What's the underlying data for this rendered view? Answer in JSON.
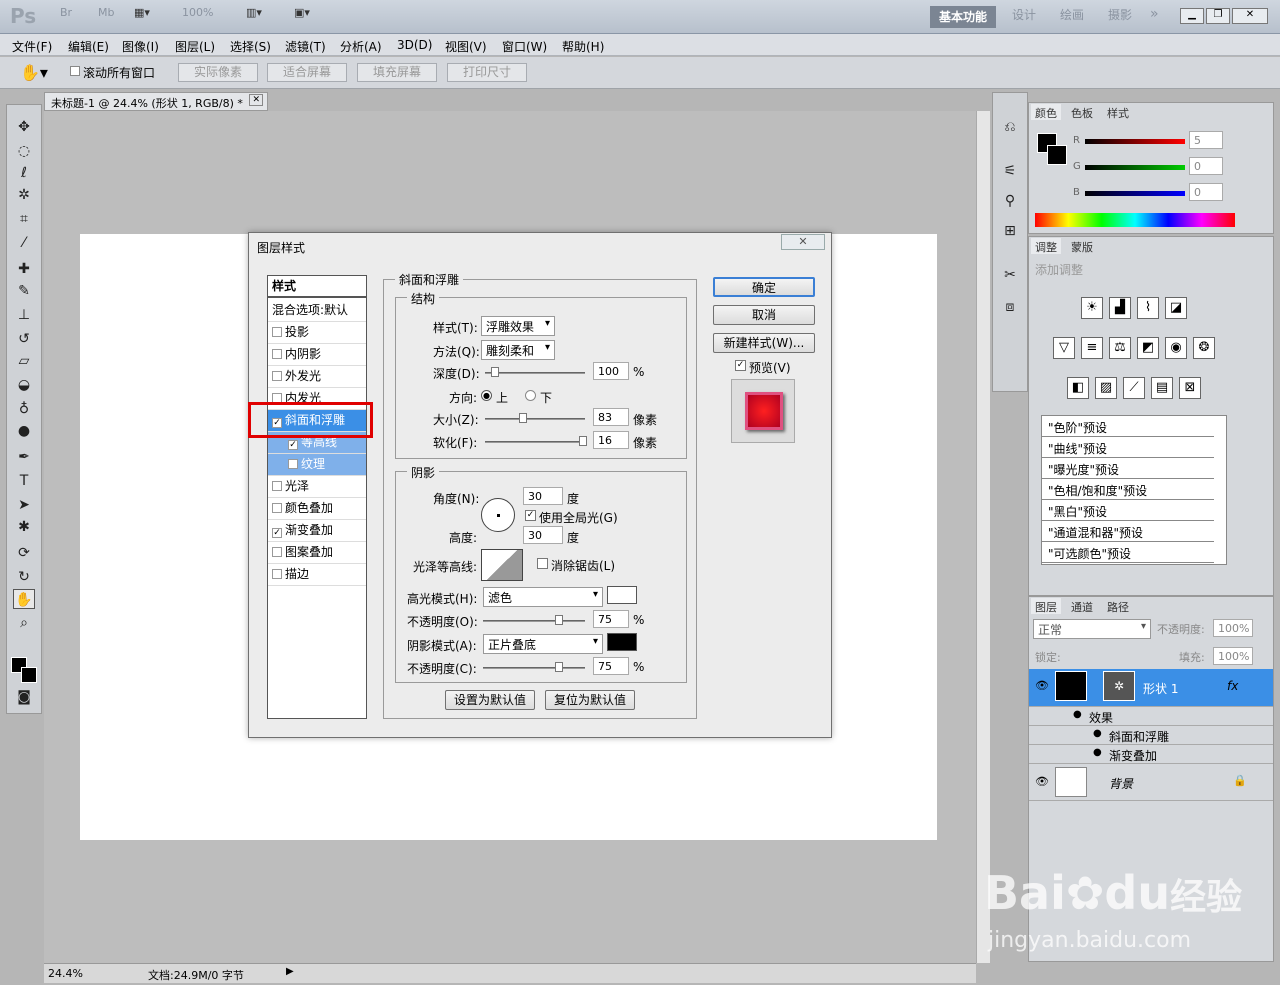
{
  "app": {
    "logo": "Ps",
    "top_items": [
      "Br",
      "Mb",
      "100%"
    ],
    "workspace": "基本功能",
    "workspaces": [
      "设计",
      "绘画",
      "摄影"
    ]
  },
  "menu": [
    "文件(F)",
    "编辑(E)",
    "图像(I)",
    "图层(L)",
    "选择(S)",
    "滤镜(T)",
    "分析(A)",
    "3D(D)",
    "视图(V)",
    "窗口(W)",
    "帮助(H)"
  ],
  "options": {
    "scroll_all": "滚动所有窗口",
    "buttons": [
      "实际像素",
      "适合屏幕",
      "填充屏幕",
      "打印尺寸"
    ]
  },
  "doc": {
    "tab": "未标题-1 @ 24.4% (形状 1, RGB/8) *",
    "zoom": "24.4%",
    "status": "文档:24.9M/0 字节"
  },
  "dialog": {
    "title": "图层样式",
    "close": "✕",
    "styles_header": "样式",
    "blend": "混合选项:默认",
    "items": [
      {
        "label": "投影",
        "checked": ""
      },
      {
        "label": "内阴影",
        "checked": ""
      },
      {
        "label": "外发光",
        "checked": ""
      },
      {
        "label": "内发光",
        "checked": ""
      },
      {
        "label": "斜面和浮雕",
        "checked": "✓"
      },
      {
        "label": "等高线",
        "checked": "✓"
      },
      {
        "label": "纹理",
        "checked": ""
      },
      {
        "label": "光泽",
        "checked": ""
      },
      {
        "label": "颜色叠加",
        "checked": ""
      },
      {
        "label": "渐变叠加",
        "checked": "✓"
      },
      {
        "label": "图案叠加",
        "checked": ""
      },
      {
        "label": "描边",
        "checked": ""
      }
    ],
    "bevel_title": "斜面和浮雕",
    "structure": "结构",
    "style_label": "样式(T):",
    "style_value": "浮雕效果",
    "method_label": "方法(Q):",
    "method_value": "雕刻柔和",
    "depth_label": "深度(D):",
    "depth_value": "100",
    "pct": "%",
    "direction_label": "方向:",
    "dir_up": "上",
    "dir_down": "下",
    "size_label": "大小(Z):",
    "size_value": "83",
    "px": "像素",
    "soften_label": "软化(F):",
    "soften_value": "16",
    "shading": "阴影",
    "angle_label": "角度(N):",
    "angle_value": "30",
    "deg": "度",
    "global_light": "使用全局光(G)",
    "altitude_label": "高度:",
    "altitude_value": "30",
    "gloss_label": "光泽等高线:",
    "antialias": "消除锯齿(L)",
    "hl_mode_label": "高光模式(H):",
    "hl_mode": "滤色",
    "opacity_label": "不透明度(O):",
    "hl_opacity": "75",
    "sh_mode_label": "阴影模式(A):",
    "sh_mode": "正片叠底",
    "opacity2_label": "不透明度(C):",
    "sh_opacity": "75",
    "set_default": "设置为默认值",
    "reset_default": "复位为默认值",
    "ok": "确定",
    "cancel": "取消",
    "new_style": "新建样式(W)...",
    "preview": "预览(V)"
  },
  "color_panel": {
    "tabs": [
      "颜色",
      "色板",
      "样式"
    ],
    "r": "5",
    "g": "0",
    "b": "0",
    "r_l": "R",
    "g_l": "G",
    "b_l": "B"
  },
  "adjust_panel": {
    "tabs": [
      "调整",
      "蒙版"
    ],
    "hint": "添加调整",
    "presets": [
      "\"色阶\"预设",
      "\"曲线\"预设",
      "\"曝光度\"预设",
      "\"色相/饱和度\"预设",
      "\"黑白\"预设",
      "\"通道混和器\"预设",
      "\"可选颜色\"预设"
    ]
  },
  "layers_panel": {
    "tabs": [
      "图层",
      "通道",
      "路径"
    ],
    "mode": "正常",
    "opacity_label": "不透明度:",
    "opacity": "100%",
    "lock_label": "锁定:",
    "fill_label": "填充:",
    "fill": "100%",
    "layer1": "形状 1",
    "effects": "效果",
    "eff1": "斜面和浮雕",
    "eff2": "渐变叠加",
    "bg": "背景",
    "fx": "fx"
  },
  "watermark": {
    "brand": "Bai",
    "brand2": "du",
    "brand3": "经验",
    "url": "jingyan.baidu.com"
  }
}
